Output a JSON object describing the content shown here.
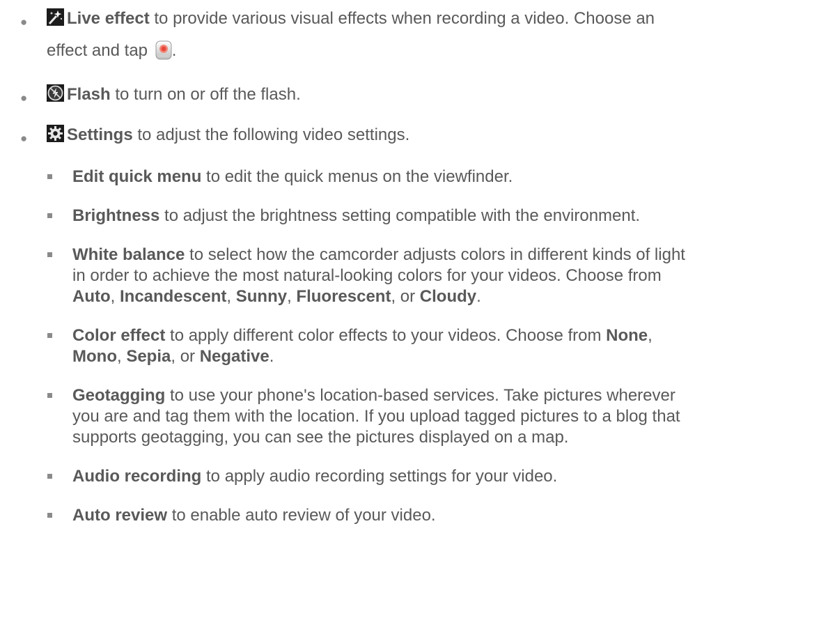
{
  "top_items": [
    {
      "icon": "live-effect-wand-icon",
      "term": "Live effect",
      "line1": " to provide various visual effects when recording a video. Choose an",
      "line2": "effect and tap ",
      "line2_end": ".",
      "tap_button_icon": "record-button-icon"
    },
    {
      "icon": "flash-off-icon",
      "term": "Flash",
      "text": " to turn on or off the flash."
    },
    {
      "icon": "gear-icon",
      "term": "Settings",
      "text": " to adjust the following video settings."
    }
  ],
  "settings": {
    "edit_quick_menu": {
      "term": "Edit quick menu",
      "text": " to edit the quick menus on the viewfinder."
    },
    "brightness": {
      "term": "Brightness",
      "text": " to adjust the brightness setting compatible with the environment."
    },
    "white_balance": {
      "term": "White balance",
      "line1": " to select how the camcorder adjusts colors in different kinds of light",
      "line2": "in order to achieve the most natural-looking colors for your videos. Choose from",
      "opt1": "Auto",
      "sep1": ", ",
      "opt2": "Incandescent",
      "sep2": ", ",
      "opt3": "Sunny",
      "sep3": ", ",
      "opt4": "Fluorescent",
      "sep4": ", or ",
      "opt5": "Cloudy",
      "end": "."
    },
    "color_effect": {
      "term": "Color effect",
      "line1": " to apply different color effects to your videos. Choose from ",
      "opt1": "None",
      "comma1": ",",
      "opt2": "Mono",
      "sep2": ", ",
      "opt3": "Sepia",
      "sep3": ", or ",
      "opt4": "Negative",
      "end": "."
    },
    "geotagging": {
      "term": "Geotagging",
      "line1": " to use your phone's location-based services. Take pictures wherever",
      "line2": "you are and tag them with the location. If you upload tagged pictures to a blog that",
      "line3": "supports geotagging, you can see the pictures displayed on a map."
    },
    "audio_recording": {
      "term": "Audio recording",
      "text": " to apply audio recording settings for your video."
    },
    "auto_review": {
      "term": "Auto review",
      "text": " to enable auto review of your video."
    }
  }
}
